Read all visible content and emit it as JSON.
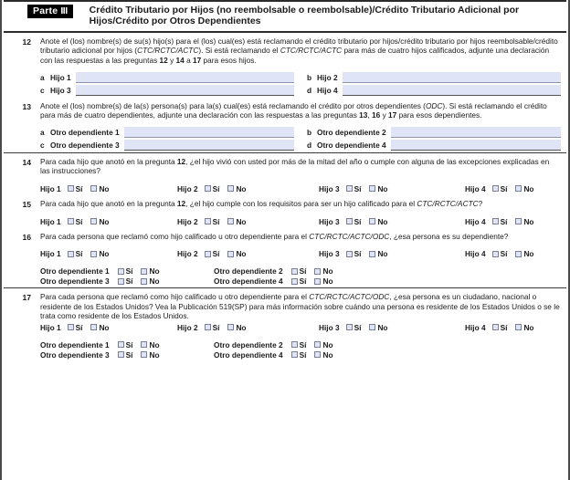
{
  "header": {
    "part_label": "Parte",
    "part_number": "III",
    "title": "Crédito Tributario por Hijos (no reembolsable o reembolsable)/Crédito Tributario Adicional por Hijos/Crédito por Otros Dependientes"
  },
  "q12": {
    "number": "12",
    "text_1": "Anote el (los) nombre(s) de su(s) hijo(s) para el (los) cual(es) está reclamando el crédito tributario por hijos/crédito tributario por hijos reembolsable/crédito tributario adicional por hijos (",
    "italic_1": "CTC/RCTC/ACTC",
    "text_2": "). Si está reclamando el ",
    "italic_2": "CTC/RCTC/ACTC",
    "text_3": " para más de cuatro hijos calificados, adjunte una declaración con las respuestas a las preguntas ",
    "bold_1": "12",
    "text_4": " y ",
    "bold_2": "14",
    "text_5": " a ",
    "bold_3": "17",
    "text_6": " para esos hijos.",
    "fields": [
      {
        "letter": "a",
        "label": "Hijo 1",
        "value": ""
      },
      {
        "letter": "b",
        "label": "Hijo 2",
        "value": ""
      },
      {
        "letter": "c",
        "label": "Hijo 3",
        "value": ""
      },
      {
        "letter": "d",
        "label": "Hijo 4",
        "value": ""
      }
    ]
  },
  "q13": {
    "number": "13",
    "text_1": "Anote el (los) nombre(s) de la(s) persona(s) para la(s) cual(es) está reclamando el crédito por otros dependientes (",
    "italic_1": "ODC",
    "text_2": "). Si está reclamando el crédito para más de cuatro dependientes, adjunte una declaración con las respuestas a las preguntas ",
    "bold_1": "13",
    "text_3": ", ",
    "bold_2": "16",
    "text_4": " y ",
    "bold_3": "17",
    "text_5": " para esos dependientes.",
    "fields": [
      {
        "letter": "a",
        "label": "Otro dependiente 1",
        "value": ""
      },
      {
        "letter": "b",
        "label": "Otro dependiente 2",
        "value": ""
      },
      {
        "letter": "c",
        "label": "Otro dependiente 3",
        "value": ""
      },
      {
        "letter": "d",
        "label": "Otro dependiente 4",
        "value": ""
      }
    ]
  },
  "q14": {
    "number": "14",
    "text_1": "Para cada hijo que anotó en la pregunta ",
    "bold_1": "12",
    "text_2": ", ¿el hijo vivió con usted por más de la mitad del año o cumple con alguna de las excepciones explicadas en las instrucciones?",
    "children": [
      {
        "label": "Hijo 1",
        "yes": "Sí",
        "no": "No"
      },
      {
        "label": "Hijo 2",
        "yes": "Sí",
        "no": "No"
      },
      {
        "label": "Hijo 3",
        "yes": "Sí",
        "no": "No"
      },
      {
        "label": "Hijo 4",
        "yes": "Sí",
        "no": "No"
      }
    ]
  },
  "q15": {
    "number": "15",
    "text_1": "Para cada hijo que anotó en la pregunta ",
    "bold_1": "12",
    "text_2": ", ¿el hijo cumple con los requisitos para ser un hijo calificado para el ",
    "italic_1": "CTC/RCTC/ACTC",
    "text_3": "?",
    "children": [
      {
        "label": "Hijo 1",
        "yes": "Sí",
        "no": "No"
      },
      {
        "label": "Hijo 2",
        "yes": "Sí",
        "no": "No"
      },
      {
        "label": "Hijo 3",
        "yes": "Sí",
        "no": "No"
      },
      {
        "label": "Hijo 4",
        "yes": "Sí",
        "no": "No"
      }
    ]
  },
  "q16": {
    "number": "16",
    "text_1": "Para cada persona que reclamó como hijo calificado u otro dependiente para el ",
    "italic_1": "CTC/RCTC/ACTC/ODC",
    "text_2": ", ¿esa persona es su dependiente?",
    "children": [
      {
        "label": "Hijo 1",
        "yes": "Sí",
        "no": "No"
      },
      {
        "label": "Hijo 2",
        "yes": "Sí",
        "no": "No"
      },
      {
        "label": "Hijo 3",
        "yes": "Sí",
        "no": "No"
      },
      {
        "label": "Hijo 4",
        "yes": "Sí",
        "no": "No"
      }
    ],
    "dependents": [
      {
        "label": "Otro dependiente 1",
        "yes": "Sí",
        "no": "No"
      },
      {
        "label": "Otro dependiente 2",
        "yes": "Sí",
        "no": "No"
      },
      {
        "label": "Otro dependiente 3",
        "yes": "Sí",
        "no": "No"
      },
      {
        "label": "Otro dependiente 4",
        "yes": "Sí",
        "no": "No"
      }
    ]
  },
  "q17": {
    "number": "17",
    "text_1": "Para cada persona que reclamó como hijo calificado u otro dependiente para el ",
    "italic_1": "CTC/RCTC/ACTC/ODC",
    "text_2": ", ¿esa persona es un ciudadano, nacional o residente de los Estados Unidos? Vea la Publicación 519(SP) para más información sobre cuándo una persona es residente de los Estados Unidos o se le trata como residente de los Estados Unidos.",
    "children": [
      {
        "label": "Hijo 1",
        "yes": "Sí",
        "no": "No"
      },
      {
        "label": "Hijo 2",
        "yes": "Sí",
        "no": "No"
      },
      {
        "label": "Hijo 3",
        "yes": "Sí",
        "no": "No"
      },
      {
        "label": "Hijo 4",
        "yes": "Sí",
        "no": "No"
      }
    ],
    "dependents": [
      {
        "label": "Otro dependiente 1",
        "yes": "Sí",
        "no": "No"
      },
      {
        "label": "Otro dependiente 2",
        "yes": "Sí",
        "no": "No"
      },
      {
        "label": "Otro dependiente 3",
        "yes": "Sí",
        "no": "No"
      },
      {
        "label": "Otro dependiente 4",
        "yes": "Sí",
        "no": "No"
      }
    ]
  },
  "colors": {
    "field_fill": "#dfe4f7",
    "checkbox_fill": "#dfe4f7",
    "rule": "#3a3a3a",
    "badge_bg": "#000000"
  }
}
